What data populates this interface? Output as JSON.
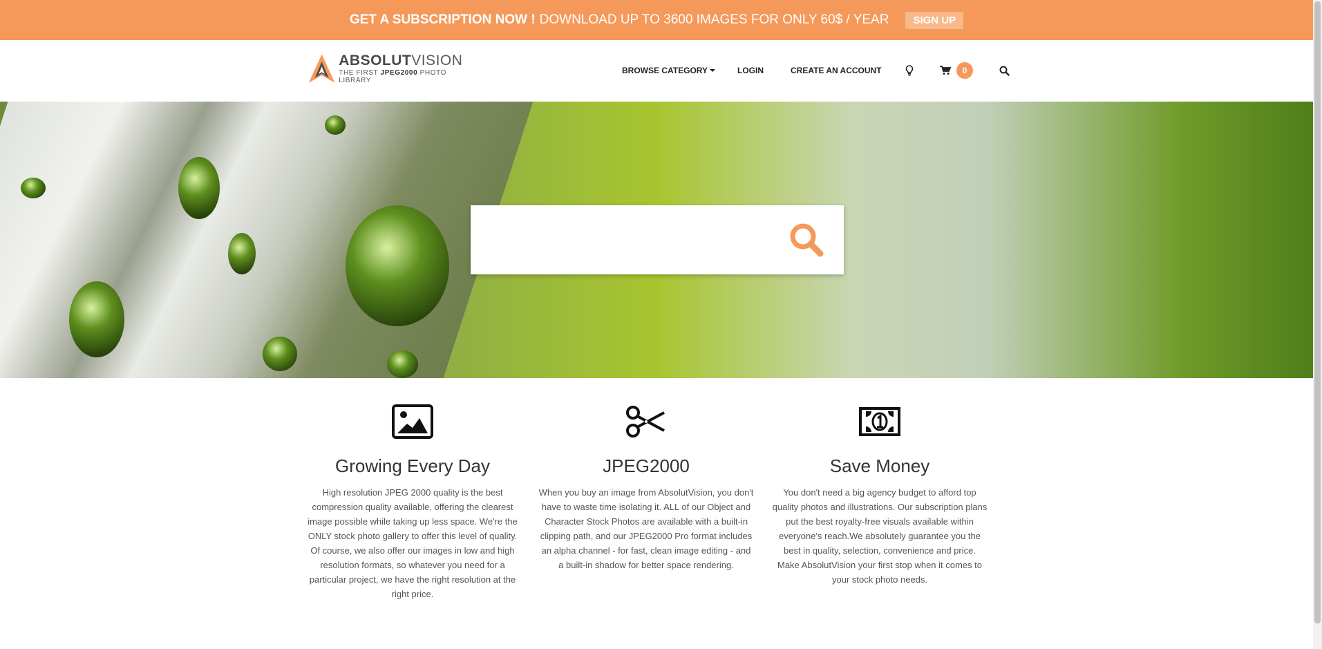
{
  "promo": {
    "bold": "GET A SUBSCRIPTION NOW !",
    "text": "DOWNLOAD UP TO 3600 IMAGES FOR ONLY 60$ / YEAR",
    "signup_label": "SIGN UP"
  },
  "logo": {
    "main_bold": "ABSOLUT",
    "main_light": "VISION",
    "sub_prefix": "THE FIRST",
    "sub_bold": "JPEG2000",
    "sub_suffix": "PHOTO LIBRARY"
  },
  "nav": {
    "browse_label": "BROWSE CATEGORY",
    "login_label": "LOGIN",
    "create_label": "CREATE AN ACCOUNT",
    "cart_count": "0"
  },
  "search": {
    "value": "",
    "placeholder": ""
  },
  "features": [
    {
      "icon": "image-icon",
      "title": "Growing Every Day",
      "text": "High resolution JPEG 2000 quality is the best compression quality available, offering the clearest image possible while taking up less space. We're the ONLY stock photo gallery to offer this level of quality. Of course, we also offer our images in low and high resolution formats, so whatever you need for a particular project, we have the right resolution at the right price."
    },
    {
      "icon": "scissors-icon",
      "title": "JPEG2000",
      "text": "When you buy an image from AbsolutVision, you don't have to waste time isolating it. ALL of our Object and Character Stock Photos are available with a built-in clipping path, and our JPEG2000 Pro format includes an alpha channel - for fast, clean image editing - and a built-in shadow for better space rendering."
    },
    {
      "icon": "money-icon",
      "title": "Save Money",
      "text": "You don't need a big agency budget to afford top quality photos and illustrations. Our subscription plans put the best royalty-free visuals available within everyone's reach.We absolutely guarantee you the best in quality, selection, convenience and price. Make AbsolutVision your first stop when it comes to your stock photo needs."
    }
  ],
  "colors": {
    "accent": "#f5995a",
    "text": "#333333"
  }
}
